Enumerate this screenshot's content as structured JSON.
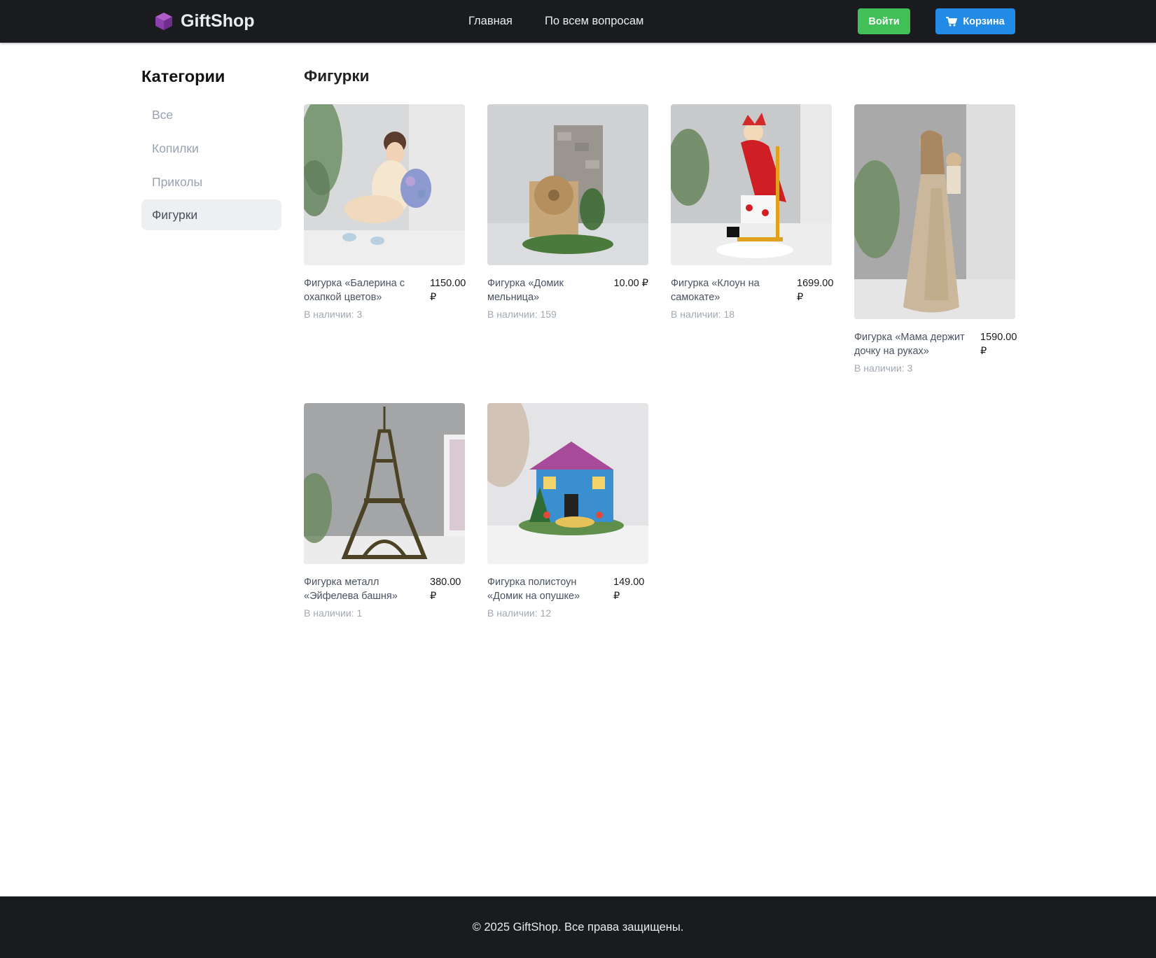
{
  "header": {
    "brand": "GiftShop",
    "nav": [
      {
        "label": "Главная"
      },
      {
        "label": "По всем вопросам"
      }
    ],
    "login_label": "Войти",
    "cart_label": "Корзина",
    "logo_icon": "gift-box-icon",
    "cart_icon": "shopping-cart-icon",
    "colors": {
      "login": "#40c057",
      "cart": "#228be6",
      "bar": "#1a1b1e"
    }
  },
  "sidebar": {
    "title": "Категории",
    "items": [
      {
        "label": "Все"
      },
      {
        "label": "Копилки"
      },
      {
        "label": "Приколы"
      },
      {
        "label": "Фигурки",
        "active": true
      }
    ]
  },
  "main": {
    "title": "Фигурки",
    "products": [
      {
        "name": "Фигурка «Балерина с охапкой цветов»",
        "price": "1150.00 ₽",
        "stock": "В наличии: 3"
      },
      {
        "name": "Фигурка «Домик мельница»",
        "price": "10.00 ₽",
        "stock": "В наличии: 159"
      },
      {
        "name": "Фигурка «Клоун на самокате»",
        "price": "1699.00 ₽",
        "stock": "В наличии: 18"
      },
      {
        "name": "Фигурка «Мама держит дочку на руках»",
        "price": "1590.00 ₽",
        "stock": "В наличии: 3"
      },
      {
        "name": "Фигурка металл «Эйфелева башня»",
        "price": "380.00 ₽",
        "stock": "В наличии: 1"
      },
      {
        "name": "Фигурка полистоун «Домик на опушке»",
        "price": "149.00 ₽",
        "stock": "В наличии: 12"
      }
    ]
  },
  "footer": {
    "text": "© 2025 GiftShop. Все права защищены."
  }
}
